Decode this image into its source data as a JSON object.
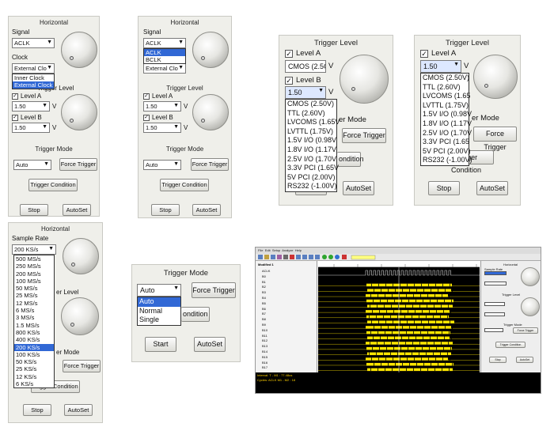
{
  "panelA": {
    "horizontal_title": "Horizontal",
    "signal_label": "Signal",
    "signal_value": "ACLK",
    "clock_label": "Clock",
    "clock_value": "External Clo",
    "clock_options": [
      "Inner Clock",
      "External Clock"
    ],
    "clock_selected_index": 1,
    "trigger_level_title": "Trigger Level",
    "level_a_label": "Level A",
    "level_a_value": "1.50",
    "level_b_label": "Level B",
    "level_b_value": "1.50",
    "trigger_mode_title": "Trigger Mode",
    "mode_value": "Auto",
    "force_trigger": "Force Trigger",
    "trigger_condition": "Trigger Condition",
    "stop": "Stop",
    "autoset": "AutoSet",
    "volt_unit": "V"
  },
  "panelB": {
    "horizontal_title": "Horizontal",
    "signal_label": "Signal",
    "signal_value": "ACLK",
    "signal_options": [
      "ACLK",
      "BCLK"
    ],
    "signal_selected_index": 0,
    "clock_value": "External Clo",
    "trigger_level_title": "Trigger Level",
    "level_a_label": "Level A",
    "level_a_value": "1.50",
    "level_b_label": "Level B",
    "level_b_value": "1.50",
    "trigger_mode_title": "Trigger Mode",
    "mode_value": "Auto",
    "force_trigger": "Force Trigger",
    "trigger_condition": "Trigger Condition",
    "stop": "Stop",
    "autoset": "AutoSet",
    "volt_unit": "V"
  },
  "panelC": {
    "trigger_level_title": "Trigger Level",
    "level_a_label": "Level A",
    "level_a_value": "CMOS (2.5C",
    "level_b_label": "Level B",
    "level_b_value": "1.50",
    "level_options": [
      "CMOS (2.50V)",
      "TTL (2.60V)",
      "LVCOMS (1.65V",
      "LVTTL (1.75V)",
      "1.5V I/O (0.98V",
      "1.8V I/O (1.17V",
      "2.5V I/O (1.70V",
      "3.3V PCI (1.65V",
      "5V PCI (2.00V)",
      "RS232 (-1.00V)"
    ],
    "mode_partial": "er Mode",
    "force_trigger": "Force Trigger",
    "condition_partial": "ondition",
    "stop": "Stop",
    "autoset": "AutoSet",
    "volt_unit": "V"
  },
  "panelD": {
    "trigger_level_title": "Trigger Level",
    "level_a_label": "Level A",
    "level_a_value": "1.50",
    "level_options": [
      "CMOS (2.50V)",
      "TTL (2.60V)",
      "LVCOMS (1.65",
      "LVTTL (1.75V)",
      "1.5V I/O (0.98V",
      "1.8V I/O (1.17V",
      "2.5V I/O (1.70V",
      "3.3V PCI (1.65",
      "5V PCI (2.00V)",
      "RS232 (-1.00V)"
    ],
    "mode_partial": "er Mode",
    "force_trigger": "Force Trigger",
    "trigger_condition": "Trigger Condition",
    "stop": "Stop",
    "autoset": "AutoSet",
    "volt_unit": "V"
  },
  "panelE": {
    "horizontal_title": "Horizontal",
    "sample_rate_label": "Sample Rate",
    "sample_rate_value": "200 KS/s",
    "rate_options": [
      "500 MS/s",
      "250 MS/s",
      "200 MS/s",
      "100 MS/s",
      "50 MS/s",
      "25 MS/s",
      "12 MS/s",
      "6 MS/s",
      "3 MS/s",
      "1.5 MS/s",
      "800 KS/s",
      "400 KS/s",
      "200 KS/s",
      "100 KS/s",
      "50 KS/s",
      "25 KS/s",
      "12 KS/s",
      "6 KS/s"
    ],
    "rate_selected_index": 12,
    "level_partial": "er Level",
    "mode_partial": "er Mode",
    "force_trigger": "Force Trigger",
    "trigger_condition": "Trigger Condition",
    "stop": "Stop",
    "autoset": "AutoSet"
  },
  "panelF": {
    "trigger_mode_title": "Trigger Mode",
    "mode_value": "Auto",
    "mode_options": [
      "Auto",
      "Normal",
      "Single"
    ],
    "mode_selected_index": 0,
    "force_trigger": "Force Trigger",
    "condition_partial": "ondition",
    "start": "Start",
    "autoset": "AutoSet"
  },
  "analyzer": {
    "menu": [
      "File",
      "Edit",
      "Setup",
      "Analyze",
      "Help"
    ],
    "channel_header": "Modified 1",
    "channels": [
      "ACLK",
      "B0",
      "B1",
      "B2",
      "B3",
      "B4",
      "B5",
      "B6",
      "B7",
      "B8",
      "B9",
      "B10",
      "B11",
      "B12",
      "B13",
      "B14",
      "B15",
      "B16",
      "B17"
    ],
    "status_line1": "Interval: T - M1 : 77.48us",
    "status_line2": "Cycles: ACLK M1 - M2 : 18",
    "side_horizontal": "Horizontal",
    "side_sample_rate": "Sample Rate",
    "side_trigger_level": "Trigger Level",
    "side_trigger_mode": "Trigger Mode",
    "side_force": "Force Trigger",
    "side_condition": "Trigger Condition",
    "side_stop": "Stop",
    "side_autoset": "AutoSet",
    "waveform_color": "#ffe600"
  }
}
